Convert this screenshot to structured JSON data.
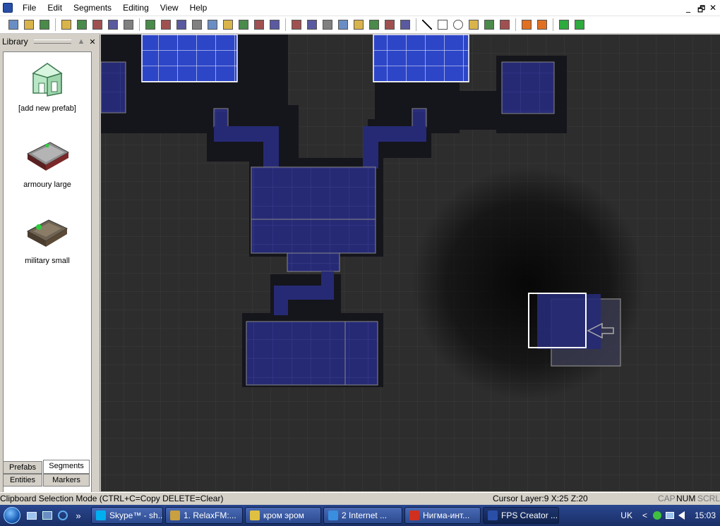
{
  "menu": {
    "items": [
      "File",
      "Edit",
      "Segments",
      "Editing",
      "View",
      "Help"
    ],
    "window_controls": [
      "_",
      "🗗",
      "✕"
    ]
  },
  "toolbar": {
    "groups": [
      [
        "new-file",
        "open-file",
        "save-file"
      ],
      [
        "cut",
        "copy",
        "paste",
        "undo",
        "redo"
      ],
      [
        "zoom-add",
        "zoom-remove",
        "view-top",
        "view-x",
        "layers",
        "zoom-in",
        "zoom-out",
        "picture",
        "magnify"
      ],
      [
        "stamp",
        "eraser",
        "paint-top",
        "paint-side",
        "pen",
        "brush",
        "pick",
        "select"
      ],
      [
        "line",
        "rectangle",
        "circle",
        "entity-a",
        "entity-b",
        "entity-c"
      ],
      [
        "flag",
        "flags"
      ],
      [
        "test-level",
        "build-game"
      ]
    ]
  },
  "library": {
    "title": "Library",
    "header_buttons": [
      "▲",
      "✕"
    ],
    "prefabs": [
      {
        "label": "[add new prefab]",
        "icon": "house-icon"
      },
      {
        "label": "armoury large",
        "icon": "armoury-room-icon"
      },
      {
        "label": "military small",
        "icon": "military-room-icon"
      }
    ],
    "tabs": [
      "Prefabs",
      "Segments",
      "Entities",
      "Markers"
    ],
    "active_tab": "Segments"
  },
  "status": {
    "mode": "Clipboard Selection Mode (CTRL+C=Copy DELETE=Clear)",
    "cursor": "Cursor Layer:9  X:25  Z:20",
    "indicators": [
      {
        "label": "CAP",
        "on": false
      },
      {
        "label": "NUM",
        "on": true
      },
      {
        "label": "SCRL",
        "on": false
      }
    ]
  },
  "taskbar": {
    "quick_launch": [
      "»"
    ],
    "tasks": [
      {
        "label": "Skype™ - sh...",
        "color": "#00aff0",
        "active": false
      },
      {
        "label": "1. RelaxFM:...",
        "color": "#c8a040",
        "active": false
      },
      {
        "label": "кром эром",
        "color": "#e0c040",
        "active": false
      },
      {
        "label": "2 Internet ...",
        "color": "#3a8ee0",
        "active": false
      },
      {
        "label": "Нигма-инт...",
        "color": "#d03020",
        "active": false
      },
      {
        "label": "FPS Creator ...",
        "color": "#2a4fa8",
        "active": true
      }
    ],
    "lang": "UK",
    "time": "15:03",
    "tray_arrow": "<"
  },
  "colors": {
    "tile_blue": "#262a75",
    "tile_bright": "#2d46c8",
    "wall_dark": "#15151c",
    "grid": "#3a3a3a",
    "viewport_bg": "#2d2d2d"
  }
}
